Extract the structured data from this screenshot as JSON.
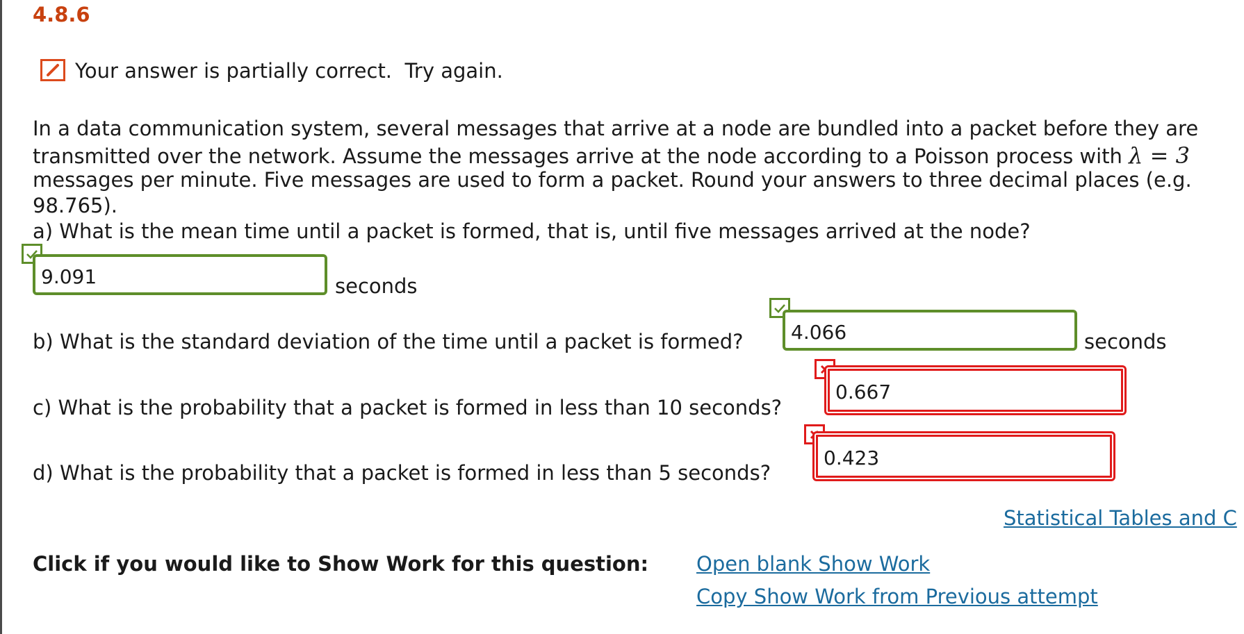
{
  "question": {
    "number": "4.8.6",
    "feedback": "Your answer is partially correct.  Try again."
  },
  "problem": {
    "line1": "In a data communication system, several messages that arrive at a node are bundled into a packet before they are",
    "line2_prefix": "transmitted over the network. Assume the messages arrive at the node according to a Poisson process with ",
    "line2_math": "λ = 3",
    "line3": "messages per minute. Five messages are used to form a packet. Round your answers to three decimal places (e.g.",
    "line4": "98.765)."
  },
  "parts": {
    "a": {
      "label": "a) What is the mean time until a packet is formed, that is, until five messages arrived at the node?",
      "value": "9.091",
      "unit": "seconds",
      "status": "correct"
    },
    "b": {
      "label": "b) What is the standard deviation of the time until a packet is formed?",
      "value": "4.066",
      "unit": "seconds",
      "status": "correct"
    },
    "c": {
      "label": "c) What is the probability that a packet is formed in less than 10 seconds?",
      "value": "0.667",
      "status": "incorrect"
    },
    "d": {
      "label": "d) What is the probability that a packet is formed in less than 5 seconds?",
      "value": "0.423",
      "status": "incorrect"
    }
  },
  "links": {
    "statistical_tables": "Statistical Tables and C",
    "open_blank_show_work": "Open blank Show Work",
    "copy_show_work": "Copy Show Work from Previous attempt"
  },
  "show_work": {
    "label": "Click if you would like to Show Work for this question:"
  },
  "colors": {
    "question_number": "#c8410f",
    "correct": "#5e8e2a",
    "incorrect": "#e01b1b",
    "link": "#1b6b9e"
  }
}
